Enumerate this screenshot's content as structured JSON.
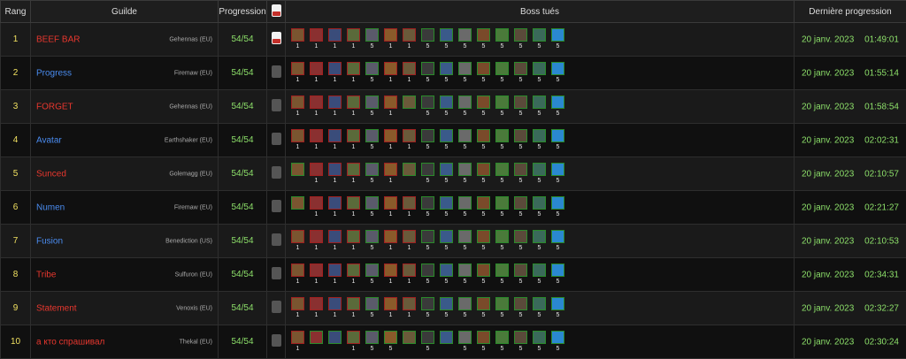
{
  "headers": {
    "rank": "Rang",
    "guild": "Guilde",
    "progression": "Progression",
    "bosses": "Boss tués",
    "last": "Dernière progression"
  },
  "colors": {
    "horde": "#e8372e",
    "alliance": "#4a8cf0",
    "progress": "#8de06a",
    "rank": "#f0e060"
  },
  "boss_icon_palette": [
    "#7a5530",
    "#8a3030",
    "#3a4c7a",
    "#5a6a3a",
    "#5a5a6a",
    "#8a5a2a",
    "#6a5a3a",
    "#3a3a3a",
    "#3a5a8a",
    "#6a6a6a",
    "#7a4a2a",
    "#4a7a3a",
    "#5a4a3a",
    "#3a6a5a",
    "#2a88d0"
  ],
  "rows": [
    {
      "rank": "1",
      "guild": "BEEF BAR",
      "faction": "horde",
      "server": "Gehennas (EU)",
      "progress": "54/54",
      "video": true,
      "kills": [
        "1",
        "1",
        "1",
        "1",
        "5",
        "1",
        "1",
        "5",
        "5",
        "5",
        "5",
        "5",
        "5",
        "5",
        "5"
      ],
      "date": "20 janv. 2023",
      "time": "01:49:01"
    },
    {
      "rank": "2",
      "guild": "Progress",
      "faction": "alliance",
      "server": "Firemaw (EU)",
      "progress": "54/54",
      "video": false,
      "kills": [
        "1",
        "1",
        "1",
        "1",
        "5",
        "1",
        "1",
        "5",
        "5",
        "5",
        "5",
        "5",
        "5",
        "5",
        "5"
      ],
      "date": "20 janv. 2023",
      "time": "01:55:14"
    },
    {
      "rank": "3",
      "guild": "FORGET",
      "faction": "horde",
      "server": "Gehennas (EU)",
      "progress": "54/54",
      "video": false,
      "kills": [
        "1",
        "1",
        "1",
        "1",
        "5",
        "1",
        "",
        "5",
        "5",
        "5",
        "5",
        "5",
        "5",
        "5",
        "5"
      ],
      "date": "20 janv. 2023",
      "time": "01:58:54"
    },
    {
      "rank": "4",
      "guild": "Avatar",
      "faction": "alliance",
      "server": "Earthshaker (EU)",
      "progress": "54/54",
      "video": false,
      "kills": [
        "1",
        "1",
        "1",
        "1",
        "5",
        "1",
        "1",
        "5",
        "5",
        "5",
        "5",
        "5",
        "5",
        "5",
        "5"
      ],
      "date": "20 janv. 2023",
      "time": "02:02:31"
    },
    {
      "rank": "5",
      "guild": "Sunced",
      "faction": "horde",
      "server": "Golemagg (EU)",
      "progress": "54/54",
      "video": false,
      "kills": [
        "",
        "1",
        "1",
        "1",
        "5",
        "1",
        "",
        "5",
        "5",
        "5",
        "5",
        "5",
        "5",
        "5",
        "5"
      ],
      "date": "20 janv. 2023",
      "time": "02:10:57"
    },
    {
      "rank": "6",
      "guild": "Numen",
      "faction": "alliance",
      "server": "Firemaw (EU)",
      "progress": "54/54",
      "video": false,
      "kills": [
        "",
        "1",
        "1",
        "1",
        "5",
        "1",
        "1",
        "5",
        "5",
        "5",
        "5",
        "5",
        "5",
        "5",
        "5"
      ],
      "date": "20 janv. 2023",
      "time": "02:21:27"
    },
    {
      "rank": "7",
      "guild": "Fusion",
      "faction": "alliance",
      "server": "Benediction (US)",
      "progress": "54/54",
      "video": false,
      "kills": [
        "1",
        "1",
        "1",
        "1",
        "5",
        "1",
        "1",
        "5",
        "5",
        "5",
        "5",
        "5",
        "5",
        "5",
        "5"
      ],
      "date": "20 janv. 2023",
      "time": "02:10:53"
    },
    {
      "rank": "8",
      "guild": "Tribe",
      "faction": "horde",
      "server": "Sulfuron (EU)",
      "progress": "54/54",
      "video": false,
      "kills": [
        "1",
        "1",
        "1",
        "1",
        "5",
        "1",
        "1",
        "5",
        "5",
        "5",
        "5",
        "5",
        "5",
        "5",
        "5"
      ],
      "date": "20 janv. 2023",
      "time": "02:34:31"
    },
    {
      "rank": "9",
      "guild": "Statement",
      "faction": "horde",
      "server": "Venoxis (EU)",
      "progress": "54/54",
      "video": false,
      "kills": [
        "1",
        "1",
        "1",
        "1",
        "5",
        "1",
        "1",
        "5",
        "5",
        "5",
        "5",
        "5",
        "5",
        "5",
        "5"
      ],
      "date": "20 janv. 2023",
      "time": "02:32:27"
    },
    {
      "rank": "10",
      "guild": "а кто спрашивал",
      "faction": "horde",
      "server": "Thekal (EU)",
      "progress": "54/54",
      "video": false,
      "kills": [
        "1",
        "",
        "",
        "1",
        "5",
        "5",
        "",
        "5",
        "",
        "5",
        "5",
        "5",
        "5",
        "5",
        "5"
      ],
      "date": "20 janv. 2023",
      "time": "02:30:24"
    }
  ]
}
